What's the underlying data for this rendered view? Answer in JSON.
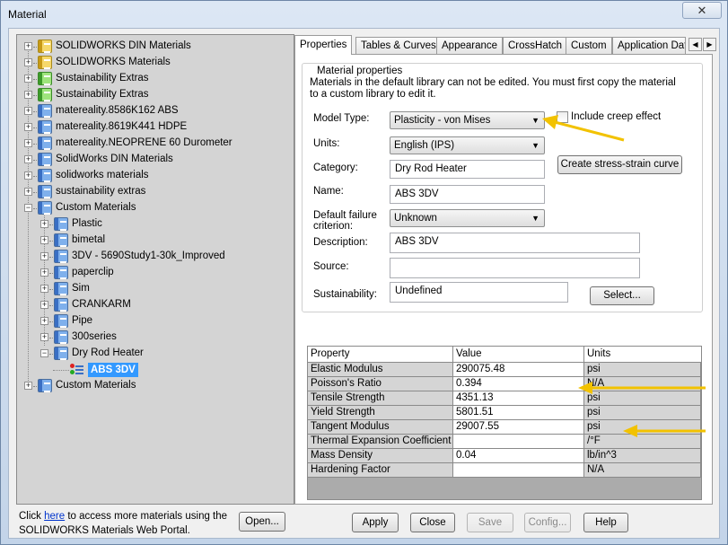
{
  "window": {
    "title": "Material",
    "close_glyph": "✕"
  },
  "tree": {
    "items": [
      {
        "label": "SOLIDWORKS DIN Materials",
        "icon": "yellow-library-icon"
      },
      {
        "label": "SOLIDWORKS Materials",
        "icon": "yellow-library-icon"
      },
      {
        "label": "Sustainability Extras",
        "icon": "green-library-icon"
      },
      {
        "label": "Sustainability Extras",
        "icon": "green-library-icon"
      },
      {
        "label": "matereality.8586K162 ABS",
        "icon": "library-icon"
      },
      {
        "label": "matereality.8619K441 HDPE",
        "icon": "library-icon"
      },
      {
        "label": "matereality.NEOPRENE 60 Durometer",
        "icon": "library-icon"
      },
      {
        "label": "SolidWorks DIN Materials",
        "icon": "library-icon"
      },
      {
        "label": "solidworks materials",
        "icon": "library-icon"
      },
      {
        "label": "sustainability extras",
        "icon": "library-icon"
      },
      {
        "label": "Custom Materials",
        "icon": "library-icon"
      },
      {
        "label": "Plastic",
        "icon": "library-icon"
      },
      {
        "label": "bimetal",
        "icon": "library-icon"
      },
      {
        "label": "3DV  - 5690Study1-30k_Improved",
        "icon": "library-icon"
      },
      {
        "label": "paperclip",
        "icon": "library-icon"
      },
      {
        "label": "Sim",
        "icon": "library-icon"
      },
      {
        "label": "CRANKARM",
        "icon": "library-icon"
      },
      {
        "label": "Pipe",
        "icon": "library-icon"
      },
      {
        "label": "300series",
        "icon": "library-icon"
      },
      {
        "label": "Dry Rod Heater",
        "icon": "library-icon"
      },
      {
        "label": "ABS 3DV",
        "icon": "material-icon"
      },
      {
        "label": "Custom Materials",
        "icon": "library-icon"
      }
    ],
    "expander_plus": "+",
    "expander_minus": "−"
  },
  "footer": {
    "text_before": "Click ",
    "link": "here",
    "text_after": " to access more materials using the SOLIDWORKS Materials Web Portal.",
    "open_button": "Open..."
  },
  "tabs": [
    "Properties",
    "Tables & Curves",
    "Appearance",
    "CrossHatch",
    "Custom",
    "Application Data"
  ],
  "tab_scroll": {
    "left": "◀",
    "right": "▶"
  },
  "properties": {
    "group_title": "Material properties",
    "info": "Materials in the default library can not be edited. You must first copy the material to a custom library to edit it.",
    "model_type_label": "Model Type:",
    "model_type_value": "Plasticity - von Mises",
    "include_creep": "Include creep effect",
    "units_label": "Units:",
    "units_value": "English (IPS)",
    "category_label": "Category:",
    "category_value": "Dry Rod Heater",
    "stress_strain_button": "Create stress-strain curve",
    "name_label": "Name:",
    "name_value": "ABS 3DV",
    "failure_label": "Default failure criterion:",
    "failure_value": "Unknown",
    "description_label": "Description:",
    "description_value": "ABS 3DV",
    "source_label": "Source:",
    "source_value": "",
    "sustainability_label": "Sustainability:",
    "sustainability_value": "Undefined",
    "select_button": "Select...",
    "dropdown_arrow": "▼"
  },
  "table": {
    "headers": [
      "Property",
      "Value",
      "Units"
    ],
    "rows": [
      [
        "Elastic Modulus",
        "290075.48",
        "psi"
      ],
      [
        "Poisson's Ratio",
        "0.394",
        "N/A"
      ],
      [
        "Tensile Strength",
        "4351.13",
        "psi"
      ],
      [
        "Yield Strength",
        "5801.51",
        "psi"
      ],
      [
        "Tangent Modulus",
        "29007.55",
        "psi"
      ],
      [
        "Thermal Expansion Coefficient",
        "",
        "/°F"
      ],
      [
        "Mass Density",
        "0.04",
        "lb/in^3"
      ],
      [
        "Hardening Factor",
        "",
        "N/A"
      ]
    ]
  },
  "buttons": {
    "apply": "Apply",
    "close": "Close",
    "save": "Save",
    "config": "Config...",
    "help": "Help"
  },
  "colors": {
    "selection": "#3399ff",
    "annotation_arrow": "#f2c200",
    "link": "#0033cc"
  }
}
